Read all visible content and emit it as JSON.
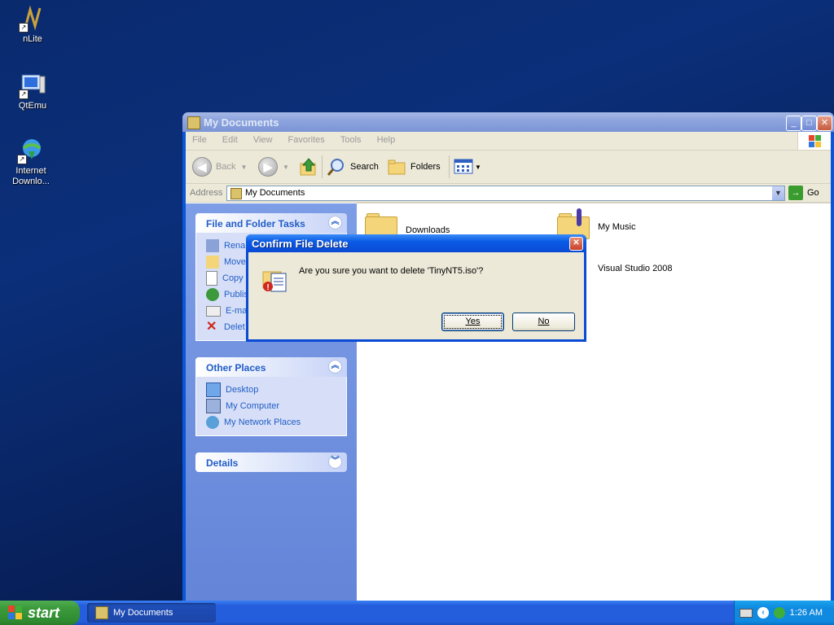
{
  "desktop": {
    "icons": [
      {
        "label": "nLite",
        "icon": "nlite-icon"
      },
      {
        "label": "QtEmu",
        "icon": "qtemu-icon"
      },
      {
        "label_line1": "Internet",
        "label_line2": "Downlo...",
        "icon": "internet-download-icon"
      }
    ]
  },
  "window": {
    "title": "My Documents",
    "menu": [
      "File",
      "Edit",
      "View",
      "Favorites",
      "Tools",
      "Help"
    ],
    "toolbar": {
      "back_label": "Back",
      "search_label": "Search",
      "folders_label": "Folders"
    },
    "address": {
      "label": "Address",
      "value": "My Documents",
      "go_label": "Go"
    },
    "left_pane": {
      "file_tasks": {
        "title": "File and Folder Tasks",
        "items": [
          "Renam",
          "Move",
          "Copy",
          "Publis",
          "E-mai",
          "Delet"
        ]
      },
      "other_places": {
        "title": "Other Places",
        "items": [
          "Desktop",
          "My Computer",
          "My Network Places"
        ]
      },
      "details": {
        "title": "Details"
      }
    },
    "items": [
      {
        "name": "Downloads"
      },
      {
        "name": "My Music"
      },
      {
        "name": "Visual Studio 2008"
      }
    ]
  },
  "dialog": {
    "title": "Confirm File Delete",
    "message": "Are you sure you want to delete 'TinyNT5.iso'?",
    "yes_label": "Yes",
    "no_label": "No"
  },
  "taskbar": {
    "start_label": "start",
    "task_label": "My Documents",
    "clock": "1:26 AM"
  },
  "colors": {
    "xp_blue": "#0a4ad4",
    "link_blue": "#215dc6",
    "start_green": "#3c9a3c",
    "dialog_face": "#ece9d8"
  }
}
